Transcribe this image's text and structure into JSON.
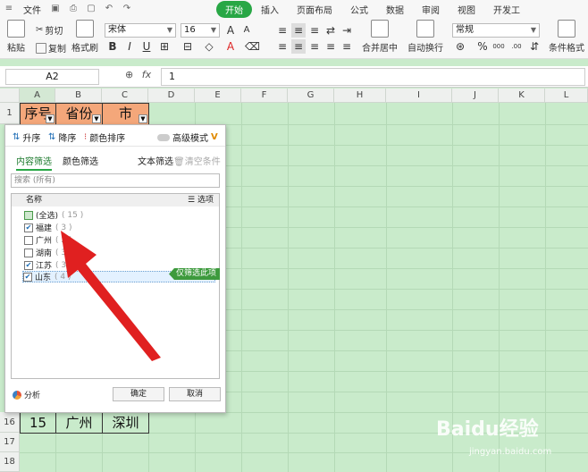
{
  "menubar": {
    "file": "文件",
    "tabs": [
      "开始",
      "插入",
      "页面布局",
      "公式",
      "数据",
      "审阅",
      "视图",
      "开发工"
    ]
  },
  "ribbon": {
    "paste": "粘贴",
    "cut": "剪切",
    "copy": "复制",
    "format_painter": "格式刷",
    "font_name": "宋体",
    "font_size": "16",
    "bold": "B",
    "italic": "I",
    "underline": "U",
    "merge_center": "合并居中",
    "wrap_text": "自动换行",
    "number_format": "常规",
    "percent": "%",
    "conditional_format": "条件格式",
    "inc_decimal": "000",
    "dec_decimal": ".00"
  },
  "formula_bar": {
    "name_box": "A2",
    "fx": "fx",
    "value": "1"
  },
  "grid": {
    "columns": [
      "A",
      "B",
      "C",
      "D",
      "E",
      "F",
      "G",
      "H",
      "I",
      "J",
      "K",
      "L"
    ],
    "rows": [
      "1",
      "16",
      "17",
      "18"
    ],
    "header_cells": [
      "序号",
      "省份",
      "市"
    ],
    "row16_cells": [
      "15",
      "广州",
      "深圳"
    ]
  },
  "filter_panel": {
    "sort_asc": "升序",
    "sort_desc": "降序",
    "sort_color": "颜色排序",
    "advanced_mode": "高级模式",
    "tab_content": "内容筛选",
    "tab_color": "颜色筛选",
    "text_filter": "文本筛选",
    "clear_condition": "清空条件",
    "search_placeholder": "搜索 (所有)",
    "list_header": "名称",
    "options": "选项",
    "items": [
      {
        "label": "(全选)",
        "count": "( 15 )"
      },
      {
        "label": "福建",
        "count": "( 3 )"
      },
      {
        "label": "广州",
        "count": "( 2 )"
      },
      {
        "label": "湖南",
        "count": "( 3 )"
      },
      {
        "label": "江苏",
        "count": "( 3 )"
      },
      {
        "label": "山东",
        "count": "( 4 )"
      }
    ],
    "only_filter": "仅筛选此项",
    "analysis": "分析",
    "ok": "确定",
    "cancel": "取消"
  },
  "watermark": {
    "brand": "Baidu经验",
    "url": "jingyan.baidu.com"
  },
  "colors": {
    "accent_green": "#28a745",
    "header_orange": "#f4a77a",
    "sheet_green": "#c9ebcb",
    "arrow_red": "#e02020"
  }
}
